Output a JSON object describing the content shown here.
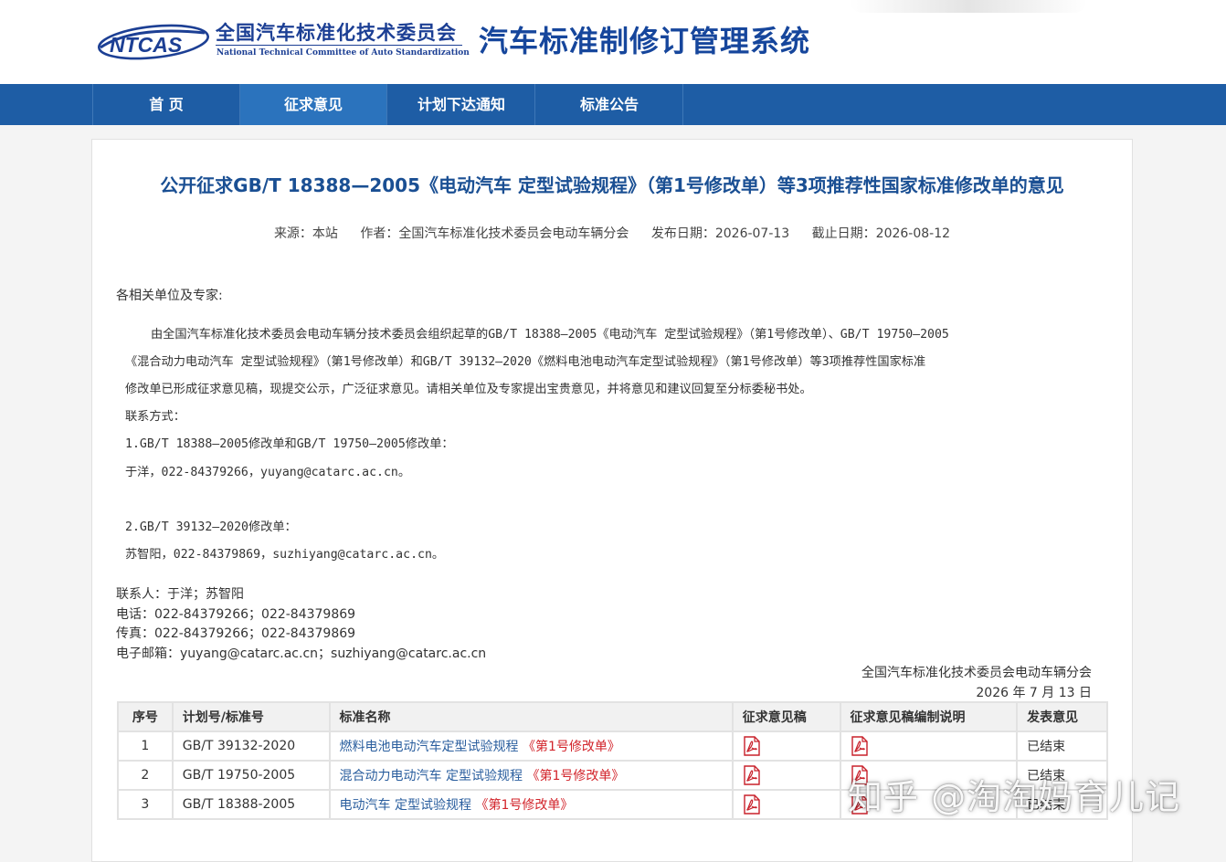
{
  "header": {
    "logo_text": "NTCAS",
    "org_cn": "全国汽车标准化技术委员会",
    "org_en": "National Technical Committee of Auto Standardization",
    "system_title": "汽车标准制修订管理系统"
  },
  "nav": {
    "items": [
      {
        "label": "首 页"
      },
      {
        "label": "征求意见"
      },
      {
        "label": "计划下达通知"
      },
      {
        "label": "标准公告"
      }
    ]
  },
  "article": {
    "title": "公开征求GB/T 18388—2005《电动汽车 定型试验规程》（第1号修改单）等3项推荐性国家标准修改单的意见",
    "meta": {
      "source": "来源：本站",
      "author": "作者：全国汽车标准化技术委员会电动车辆分会",
      "publish_date": "发布日期：2026-07-13",
      "deadline": "截止日期：2026-08-12"
    },
    "salutation": "各相关单位及专家:",
    "body": [
      "由全国汽车标准化技术委员会电动车辆分技术委员会组织起草的GB/T 18388—2005《电动汽车 定型试验规程》（第1号修改单）、GB/T 19750—2005",
      "《混合动力电动汽车 定型试验规程》（第1号修改单）和GB/T 39132—2020《燃料电池电动汽车定型试验规程》（第1号修改单）等3项推荐性国家标准",
      "修改单已形成征求意见稿，现提交公示，广泛征求意见。请相关单位及专家提出宝贵意见，并将意见和建议回复至分标委秘书处。"
    ],
    "contact_heading": "联系方式：",
    "contact1_title": "1.GB/T 18388—2005修改单和GB/T 19750—2005修改单：",
    "contact1_info": "于洋，022-84379266，yuyang@catarc.ac.cn。",
    "contact2_title": "2.GB/T 39132—2020修改单：",
    "contact2_info": "苏智阳，022-84379869，suzhiyang@catarc.ac.cn。",
    "contact_person": "联系人：于洋；苏智阳",
    "phone": "电话：022-84379266；022-84379869",
    "fax": "传真：022-84379266；022-84379869",
    "email": "电子邮箱：yuyang@catarc.ac.cn；suzhiyang@catarc.ac.cn",
    "signature_org": "全国汽车标准化技术委员会电动车辆分会",
    "signature_date": "2026 年 7 月 13 日"
  },
  "table": {
    "headers": [
      "序号",
      "计划号/标准号",
      "标准名称",
      "征求意见稿",
      "征求意见稿编制说明",
      "发表意见"
    ],
    "rows": [
      {
        "no": "1",
        "code": "GB/T 39132-2020",
        "name": "燃料电池电动汽车定型试验规程",
        "amend": "《第1号修改单》",
        "status": "已结束"
      },
      {
        "no": "2",
        "code": "GB/T 19750-2005",
        "name": "混合动力电动汽车 定型试验规程",
        "amend": "《第1号修改单》",
        "status": "已结束"
      },
      {
        "no": "3",
        "code": "GB/T 18388-2005",
        "name": "电动汽车 定型试验规程",
        "amend": "《第1号修改单》",
        "status": "已结束"
      }
    ]
  },
  "watermark": "知乎 @淘淘妈育儿记",
  "colors": {
    "nav_bg": "#1e5da5",
    "nav_active": "#2b73bd",
    "title_blue": "#1a4f93",
    "link_blue": "#2a5e9e",
    "amend_red": "#d2232a"
  }
}
